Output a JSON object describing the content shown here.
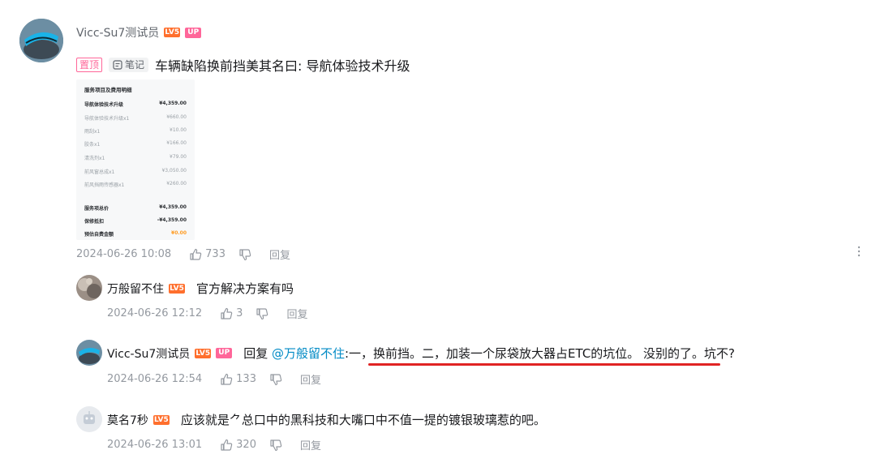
{
  "main_comment": {
    "username": "Vicc-Su7测试员",
    "level_badge": "LV5",
    "up_badge": "UP",
    "pin_label": "置顶",
    "note_label": "笔记",
    "text": "车辆缺陷换前挡美其名曰: 导航体验技术升级",
    "date": "2024-06-26 10:08",
    "likes": "733",
    "reply_label": "回复",
    "image": {
      "title": "服务项目及费用明细",
      "items": [
        {
          "label": "导航体验技术升级",
          "value": "¥4,359.00"
        },
        {
          "label": "导航体验技术升级x1",
          "value": "¥660.00"
        },
        {
          "label": "雨刮x1",
          "value": "¥10.00"
        },
        {
          "label": "胶条x1",
          "value": "¥166.00"
        },
        {
          "label": "清洗剂x1",
          "value": "¥79.00"
        },
        {
          "label": "前风窗总成x1",
          "value": "¥3,050.00"
        },
        {
          "label": "前风挡雨传感器x1",
          "value": "¥260.00"
        }
      ],
      "summary": [
        {
          "label": "服务项总价",
          "value": "¥4,359.00"
        },
        {
          "label": "保修抵扣",
          "value": "-¥4,359.00"
        },
        {
          "label": "预估自费金额",
          "value": "¥0.00"
        }
      ]
    }
  },
  "replies": [
    {
      "username": "万般留不住",
      "level_badge": "LV5",
      "text": "官方解决方案有吗",
      "date": "2024-06-26 12:12",
      "likes": "3",
      "reply_label": "回复"
    },
    {
      "username": "Vicc-Su7测试员",
      "level_badge": "LV5",
      "up_badge": "UP",
      "reply_prefix": "回复",
      "mention": "@万般留不住",
      "text": ":一，换前挡。二，加装一个尿袋放大器占ETC的坑位。 没别的了。坑不?",
      "date": "2024-06-26 12:54",
      "likes": "133",
      "reply_label": "回复"
    },
    {
      "username": "莫名7秒",
      "level_badge": "LV5",
      "text": "应该就是⺈总口中的黑科技和大嘴口中不值一提的镀银玻璃惹的吧。",
      "date": "2024-06-26 13:01",
      "likes": "320",
      "reply_label": "回复"
    }
  ],
  "colors": {
    "underline": "#e02424",
    "mention": "#008ac5",
    "badge_up": "#ff6699",
    "badge_level": "#ff6f2d"
  },
  "icons": [
    "thumb-up-icon",
    "thumb-down-icon",
    "more-vertical-icon",
    "note-icon"
  ]
}
